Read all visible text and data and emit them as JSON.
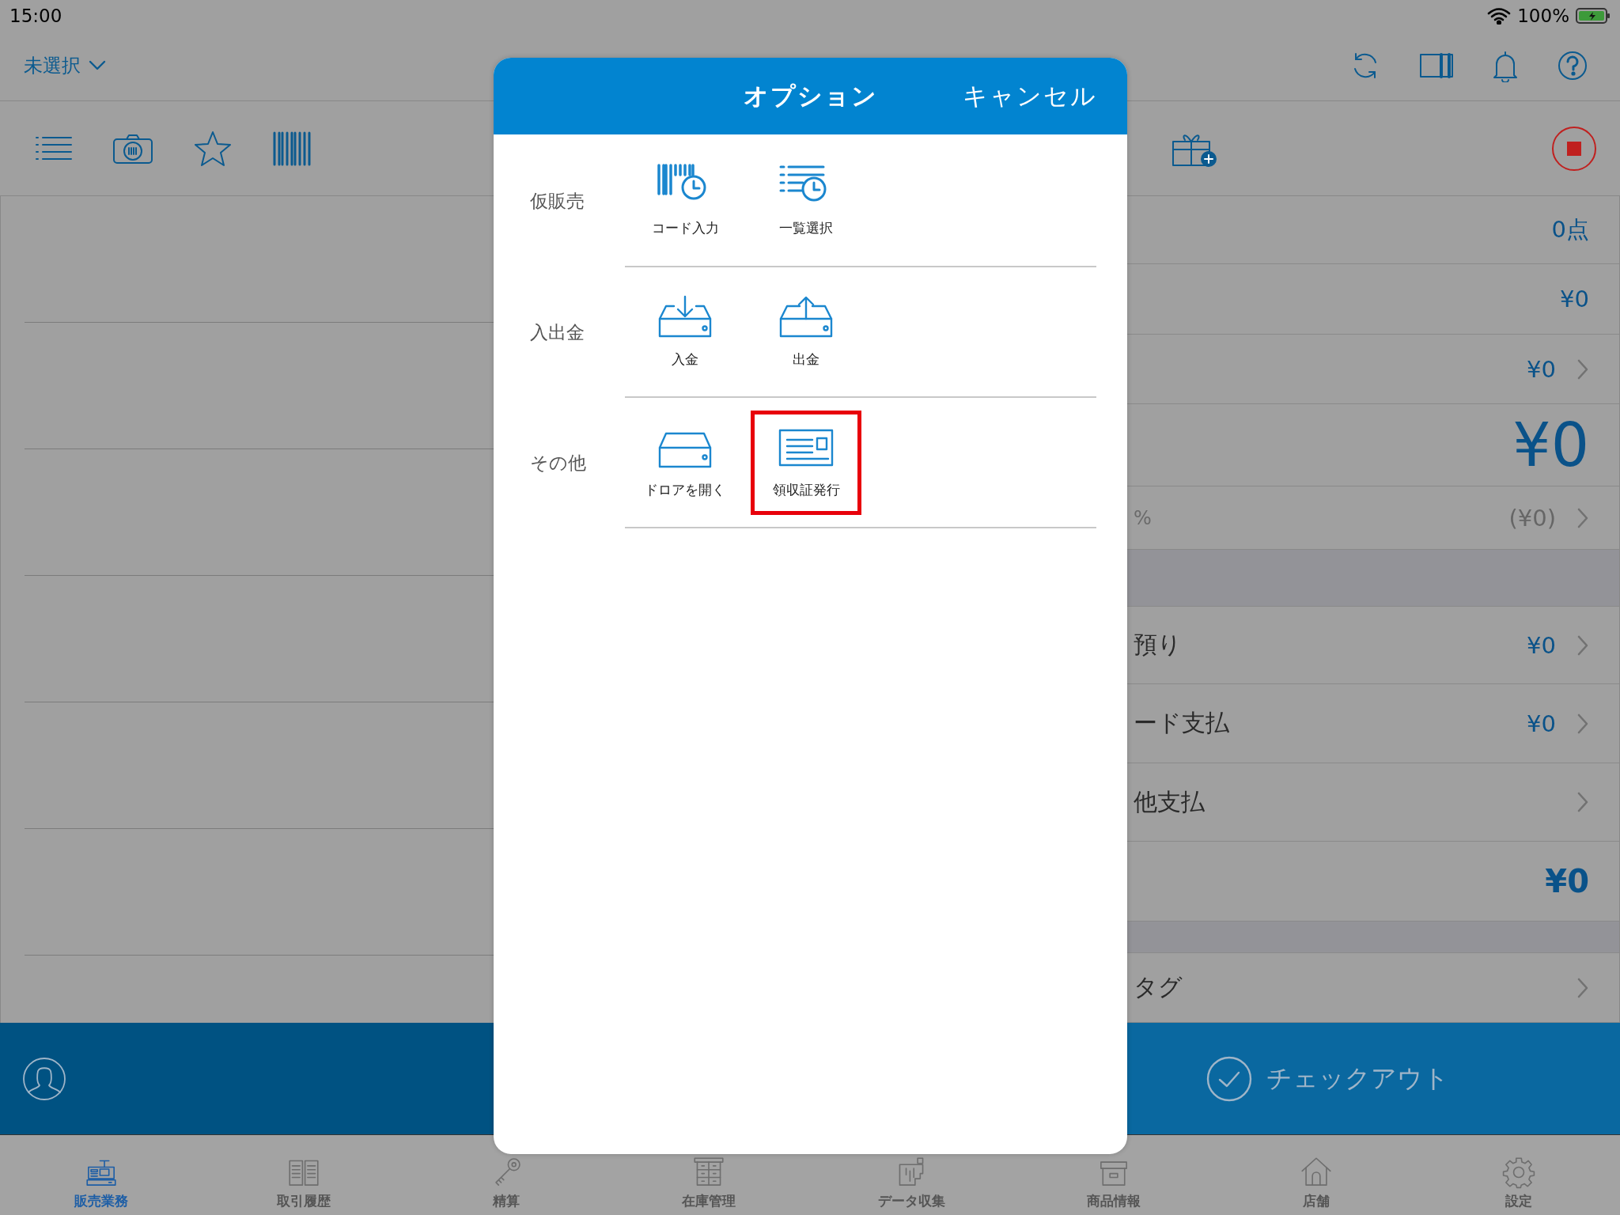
{
  "status_bar": {
    "time": "15:00",
    "battery": "100%"
  },
  "nav_bar": {
    "store_picker": "未選択"
  },
  "summary_rows": [
    {
      "kind": "value",
      "value": "0点"
    },
    {
      "kind": "value",
      "value": "¥0"
    },
    {
      "kind": "link",
      "value": "¥0"
    },
    {
      "kind": "total",
      "value": "¥0"
    },
    {
      "kind": "tax",
      "label": "%",
      "value": "(¥0)"
    },
    {
      "kind": "gap_large"
    },
    {
      "kind": "link",
      "label": "預り",
      "value": "¥0"
    },
    {
      "kind": "link",
      "label": "ード支払",
      "value": "¥0"
    },
    {
      "kind": "link",
      "label": "他支払"
    },
    {
      "kind": "strong",
      "value": "¥0"
    },
    {
      "kind": "gap_small"
    },
    {
      "kind": "link",
      "label": "タグ"
    }
  ],
  "checkout": {
    "label": "チェックアウト"
  },
  "tabs": [
    {
      "label": "販売業務",
      "selected": true
    },
    {
      "label": "取引履歴",
      "selected": false
    },
    {
      "label": "精算",
      "selected": false
    },
    {
      "label": "在庫管理",
      "selected": false
    },
    {
      "label": "データ収集",
      "selected": false
    },
    {
      "label": "商品情報",
      "selected": false
    },
    {
      "label": "店舗",
      "selected": false
    },
    {
      "label": "設定",
      "selected": false
    }
  ],
  "options": {
    "title": "オプション",
    "cancel": "キャンセル",
    "sections": [
      {
        "label": "仮販売",
        "items": [
          {
            "label": "コード入力",
            "highlighted": false
          },
          {
            "label": "一覧選択",
            "highlighted": false
          }
        ]
      },
      {
        "label": "入出金",
        "items": [
          {
            "label": "入金",
            "highlighted": false
          },
          {
            "label": "出金",
            "highlighted": false
          }
        ]
      },
      {
        "label": "その他",
        "items": [
          {
            "label": "ドロアを開く",
            "highlighted": false
          },
          {
            "label": "領収証発行",
            "highlighted": true
          }
        ]
      }
    ]
  }
}
